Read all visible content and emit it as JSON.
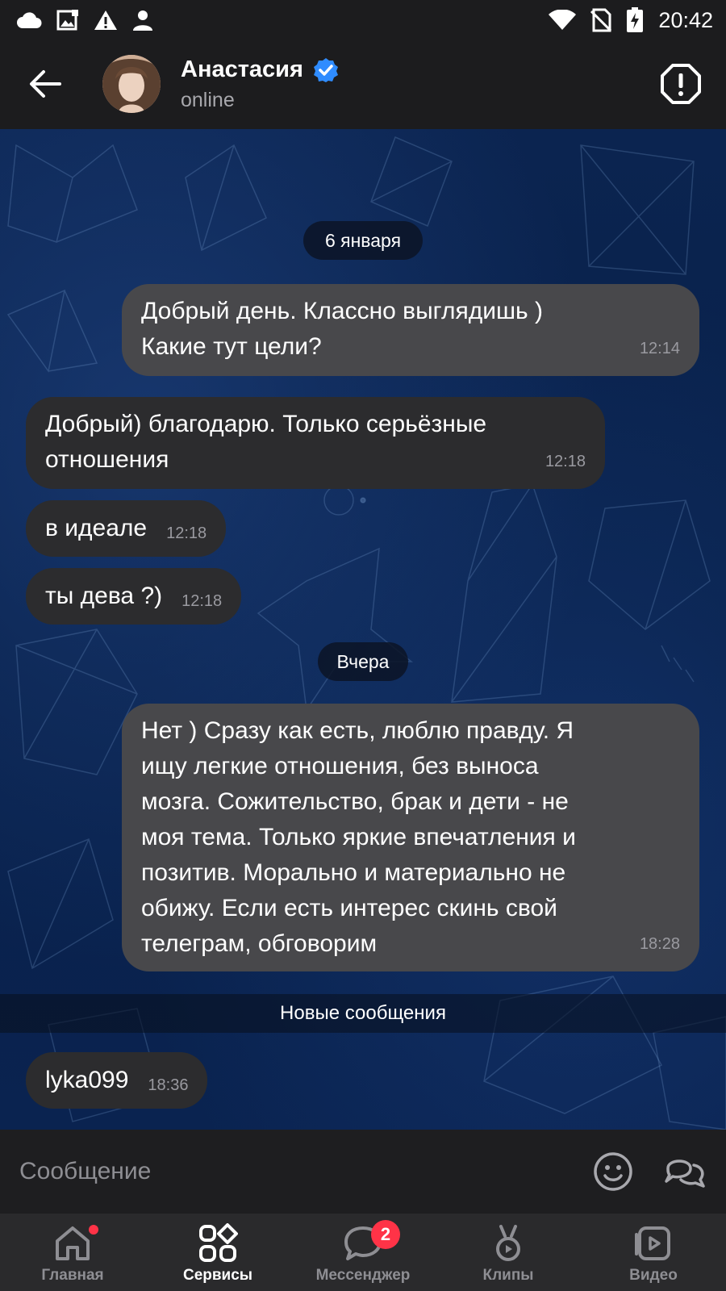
{
  "status_bar": {
    "time": "20:42",
    "left_icons": [
      "cloud-icon",
      "image-icon",
      "warning-icon",
      "person-icon"
    ],
    "right_icons": [
      "wifi-icon",
      "no-sim-icon",
      "battery-charging-icon"
    ]
  },
  "header": {
    "name": "Анастасия",
    "status": "online",
    "verified": true
  },
  "chat": {
    "date_1": "6 января",
    "date_2": "Вчера",
    "new_messages_label": "Новые сообщения",
    "messages": [
      {
        "direction": "out",
        "text": "Добрый день. Классно выглядишь )\nКакие тут цели?",
        "time": "12:14"
      },
      {
        "direction": "in",
        "text": "Добрый) благодарю. Только серьёзные\nотношения",
        "time": "12:18"
      },
      {
        "direction": "in",
        "text": "в идеале",
        "time": "12:18"
      },
      {
        "direction": "in",
        "text": "ты дева ?)",
        "time": "12:18"
      },
      {
        "direction": "out",
        "text": "Нет ) Сразу как есть, люблю правду. Я\nищу легкие отношения, без выноса\nмозга. Сожительство, брак и дети - не\nмоя тема. Только яркие впечатления и\nпозитив. Морально и материально не\nобижу. Если есть интерес скинь свой\nтелеграм, обговорим",
        "time": "18:28"
      },
      {
        "direction": "in",
        "text": "lyka099",
        "time": "18:36"
      }
    ]
  },
  "input": {
    "placeholder": "Сообщение"
  },
  "nav": {
    "items": [
      {
        "label": "Главная",
        "icon": "home-icon",
        "has_dot": true
      },
      {
        "label": "Сервисы",
        "icon": "services-icon",
        "active": true
      },
      {
        "label": "Мессенджер",
        "icon": "messenger-icon",
        "badge": "2"
      },
      {
        "label": "Клипы",
        "icon": "clips-icon"
      },
      {
        "label": "Видео",
        "icon": "video-icon"
      }
    ]
  },
  "colors": {
    "verified": "#2f8cff",
    "badge": "#ff3347",
    "bubble_out": "#48484b",
    "bubble_in": "#2c2c2e"
  }
}
